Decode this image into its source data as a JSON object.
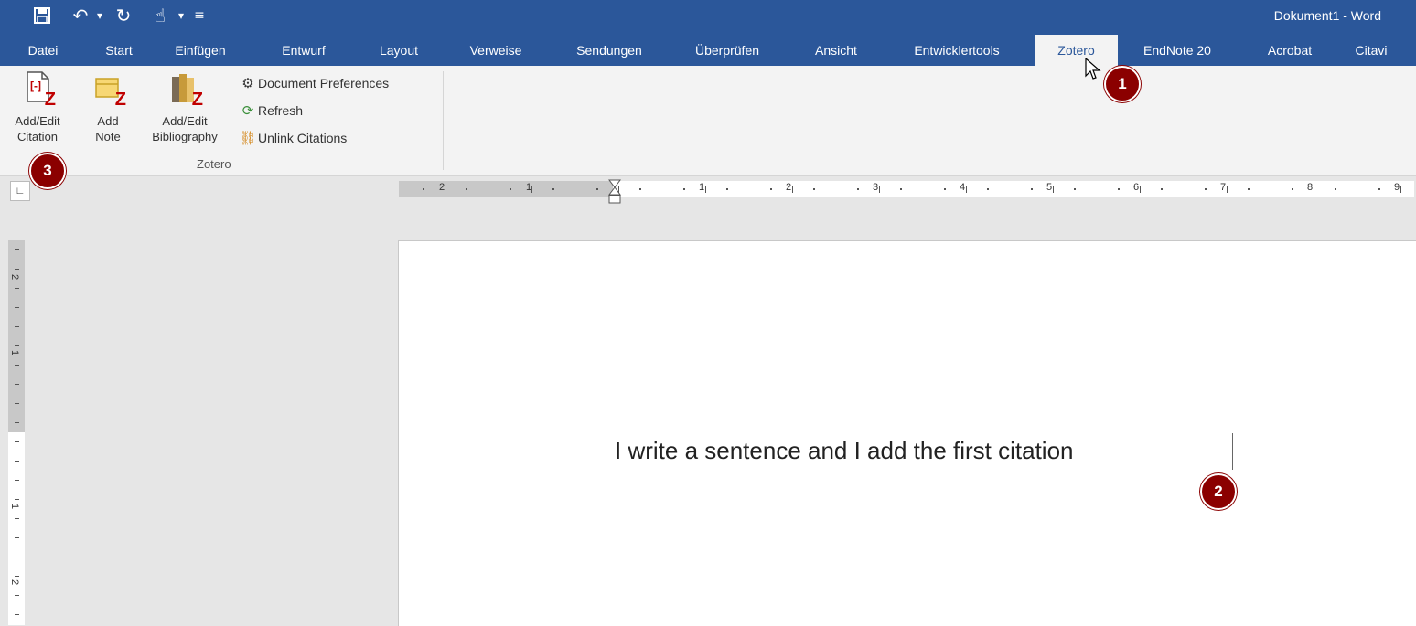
{
  "window": {
    "title": "Dokument1 - Word"
  },
  "quick_access": [
    {
      "name": "save-icon",
      "glyph": "🖫"
    },
    {
      "name": "undo-icon",
      "glyph": "↶"
    },
    {
      "name": "redo-icon",
      "glyph": "↻"
    },
    {
      "name": "touch-mode-icon",
      "glyph": "☝"
    },
    {
      "name": "customize-qat-icon",
      "glyph": "⌄"
    }
  ],
  "tabs": [
    {
      "label": "Datei"
    },
    {
      "label": "Start"
    },
    {
      "label": "Einfügen"
    },
    {
      "label": "Entwurf"
    },
    {
      "label": "Layout"
    },
    {
      "label": "Verweise"
    },
    {
      "label": "Sendungen"
    },
    {
      "label": "Überprüfen"
    },
    {
      "label": "Ansicht"
    },
    {
      "label": "Entwicklertools"
    },
    {
      "label": "Zotero",
      "active": true
    },
    {
      "label": "EndNote 20"
    },
    {
      "label": "Acrobat"
    },
    {
      "label": "Citavi"
    }
  ],
  "ribbon": {
    "group_label": "Zotero",
    "add_edit_citation": {
      "line1": "Add/Edit",
      "line2": "Citation"
    },
    "add_note": {
      "line1": "Add",
      "line2": "Note"
    },
    "add_edit_bibliography": {
      "line1": "Add/Edit",
      "line2": "Bibliography"
    },
    "document_preferences": "Document Preferences",
    "refresh": "Refresh",
    "unlink_citations": "Unlink Citations"
  },
  "ruler": {
    "horizontal_numbers": [
      "2",
      "1",
      "1",
      "2",
      "3",
      "4",
      "5",
      "6",
      "7",
      "8",
      "9"
    ],
    "vertical_numbers": [
      "2",
      "1",
      "1",
      "2"
    ]
  },
  "document": {
    "text": "I write a sentence and I add the first citation"
  },
  "markers": [
    "1",
    "2",
    "3"
  ],
  "colors": {
    "title_bar": "#2b579a",
    "ribbon": "#f3f3f3",
    "marker": "#8b0000",
    "zotero_red": "#c00000"
  }
}
